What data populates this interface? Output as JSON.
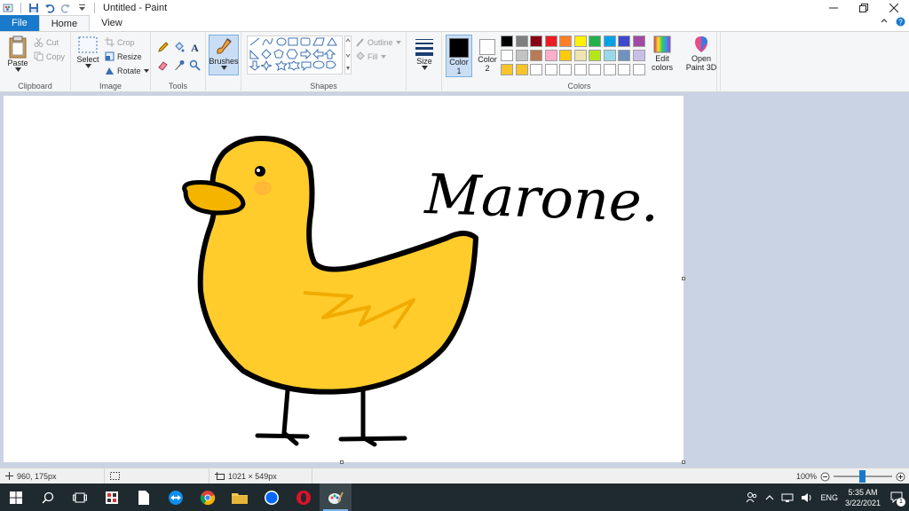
{
  "window": {
    "title": "Untitled - Paint"
  },
  "tabs": {
    "file": "File",
    "home": "Home",
    "view": "View"
  },
  "clipboard": {
    "paste": "Paste",
    "cut": "Cut",
    "copy": "Copy",
    "label": "Clipboard"
  },
  "image": {
    "select": "Select",
    "crop": "Crop",
    "resize": "Resize",
    "rotate": "Rotate",
    "label": "Image"
  },
  "tools": {
    "label": "Tools"
  },
  "brushes": {
    "label": "Brushes"
  },
  "shapes": {
    "outline": "Outline",
    "fill": "Fill",
    "label": "Shapes"
  },
  "size": {
    "label": "Size"
  },
  "colors": {
    "color1_label": "Color",
    "color1_num": "1",
    "color2_label": "Color",
    "color2_num": "2",
    "edit_line1": "Edit",
    "edit_line2": "colors",
    "label": "Colors",
    "color1_value": "#000000",
    "color2_value": "#ffffff",
    "palette": [
      "#000000",
      "#7f7f7f",
      "#880015",
      "#ed1c24",
      "#ff7f27",
      "#fff200",
      "#22b14c",
      "#00a2e8",
      "#3f48cc",
      "#a349a4",
      "#ffffff",
      "#c3c3c3",
      "#b97a57",
      "#ffaec9",
      "#ffc90e",
      "#efe4b0",
      "#b5e61d",
      "#99d9ea",
      "#7092be",
      "#c8bfe7",
      "#f7c52b",
      "#f7c52b",
      "#ffffff",
      "#ffffff",
      "#ffffff",
      "#ffffff",
      "#ffffff",
      "#ffffff",
      "#ffffff",
      "#ffffff"
    ]
  },
  "paint3d": {
    "line1": "Open",
    "line2": "Paint 3D"
  },
  "drawing": {
    "handwriting": "Marone.",
    "body_color": "#ffcc2b",
    "beak_color": "#f5b400",
    "outline_color": "#000000"
  },
  "status": {
    "cursor_pos": "960, 175px",
    "canvas_size": "1021 × 549px",
    "zoom": "100%"
  },
  "taskbar": {
    "lang": "ENG",
    "time": "5:35 AM",
    "date": "3/22/2021",
    "notifications": "1"
  }
}
